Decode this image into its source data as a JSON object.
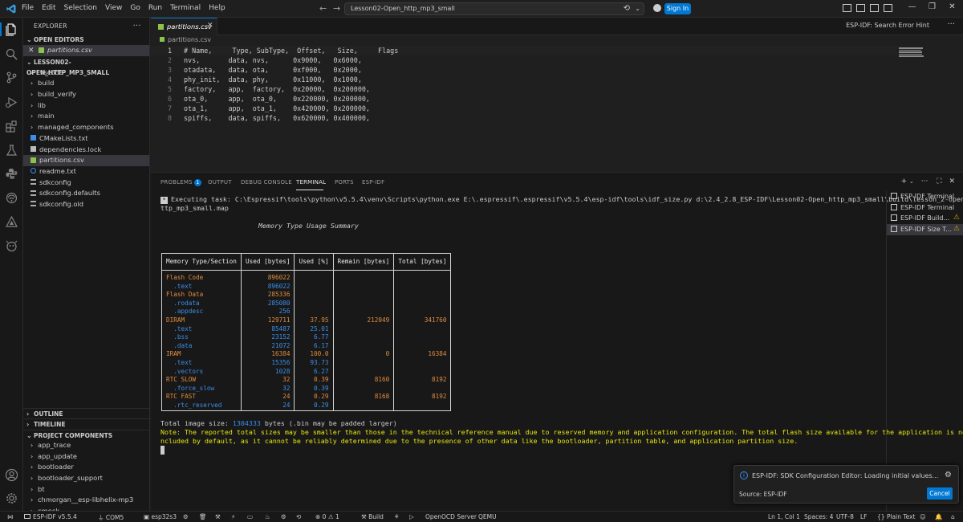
{
  "title_bar": {
    "menus": [
      "File",
      "Edit",
      "Selection",
      "View",
      "Go",
      "Run",
      "Terminal",
      "Help"
    ],
    "search_text": "Lesson02-Open_http_mp3_small",
    "sign_in": "Sign In"
  },
  "explorer": {
    "header": "EXPLORER",
    "open_editors_label": "OPEN EDITORS",
    "open_editor_file": "partitions.csv",
    "project_label": "LESSON02-OPEN_HTTP_MP3_SMALL",
    "items": [
      {
        "label": ".vscode",
        "kind": "folder"
      },
      {
        "label": "build",
        "kind": "folder"
      },
      {
        "label": "build_verify",
        "kind": "folder"
      },
      {
        "label": "lib",
        "kind": "folder"
      },
      {
        "label": "main",
        "kind": "folder"
      },
      {
        "label": "managed_components",
        "kind": "folder"
      },
      {
        "label": "CMakeLists.txt",
        "kind": "file"
      },
      {
        "label": "dependencies.lock",
        "kind": "file"
      },
      {
        "label": "partitions.csv",
        "kind": "file"
      },
      {
        "label": "readme.txt",
        "kind": "file"
      },
      {
        "label": "sdkconfig",
        "kind": "file"
      },
      {
        "label": "sdkconfig.defaults",
        "kind": "file"
      },
      {
        "label": "sdkconfig.old",
        "kind": "file"
      }
    ],
    "outline_label": "OUTLINE",
    "timeline_label": "TIMELINE",
    "project_components_label": "PROJECT COMPONENTS",
    "components": [
      "app_trace",
      "app_update",
      "bootloader",
      "bootloader_support",
      "bt",
      "chmorgan__esp-libhelix-mp3",
      "cmock"
    ]
  },
  "editor": {
    "tab_label": "partitions.csv",
    "right_label": "ESP-IDF: Search Error Hint",
    "breadcrumb": "partitions.csv",
    "lines": [
      "# Name,     Type, SubType,  Offset,   Size,     Flags",
      "nvs,       data, nvs,      0x9000,   0x6000,",
      "otadata,   data, ota,      0xf000,   0x2000,",
      "phy_init,  data, phy,      0x11000,  0x1000,",
      "factory,   app,  factory,  0x20000,  0x200000,",
      "ota_0,     app,  ota_0,    0x220000, 0x200000,",
      "ota_1,     app,  ota_1,    0x420000, 0x200000,",
      "spiffs,    data, spiffs,   0x620000, 0x400000,"
    ]
  },
  "panel": {
    "tabs": [
      "PROBLEMS",
      "OUTPUT",
      "DEBUG CONSOLE",
      "TERMINAL",
      "PORTS",
      "ESP-IDF"
    ],
    "problems_count": "1",
    "exec_line1": "Executing task: C:\\Espressif\\tools\\python\\v5.5.4\\venv\\Scripts\\python.exe E:\\.espressif\\.espressif\\v5.5.4\\esp-idf\\tools\\idf_size.py d:\\2.4_2.8_ESP-IDF\\Lesson02-Open_http_mp3_small\\build\\lesson_2-open_h",
    "exec_line2": "ttp_mp3_small.map",
    "summary_title": "Memory Type Usage Summary",
    "table_headers": [
      "Memory Type/Section",
      "Used [bytes]",
      "Used [%]",
      "Remain [bytes]",
      "Total [bytes]"
    ],
    "table_rows": [
      {
        "name": "Flash Code",
        "used": "896022",
        "pct": "",
        "remain": "",
        "total": "",
        "sub": false
      },
      {
        "name": "  .text",
        "used": "896022",
        "pct": "",
        "remain": "",
        "total": "",
        "sub": true
      },
      {
        "name": "Flash Data",
        "used": "285336",
        "pct": "",
        "remain": "",
        "total": "",
        "sub": false
      },
      {
        "name": "  .rodata",
        "used": "285080",
        "pct": "",
        "remain": "",
        "total": "",
        "sub": true
      },
      {
        "name": "  .appdesc",
        "used": "256",
        "pct": "",
        "remain": "",
        "total": "",
        "sub": true
      },
      {
        "name": "DIRAM",
        "used": "129711",
        "pct": "37.95",
        "remain": "212049",
        "total": "341760",
        "sub": false
      },
      {
        "name": "  .text",
        "used": "85487",
        "pct": "25.01",
        "remain": "",
        "total": "",
        "sub": true
      },
      {
        "name": "  .bss",
        "used": "23152",
        "pct": "6.77",
        "remain": "",
        "total": "",
        "sub": true
      },
      {
        "name": "  .data",
        "used": "21072",
        "pct": "6.17",
        "remain": "",
        "total": "",
        "sub": true
      },
      {
        "name": "IRAM",
        "used": "16384",
        "pct": "100.0",
        "remain": "0",
        "total": "16384",
        "sub": false
      },
      {
        "name": "  .text",
        "used": "15356",
        "pct": "93.73",
        "remain": "",
        "total": "",
        "sub": true
      },
      {
        "name": "  .vectors",
        "used": "1028",
        "pct": "6.27",
        "remain": "",
        "total": "",
        "sub": true
      },
      {
        "name": "RTC SLOW",
        "used": "32",
        "pct": "0.39",
        "remain": "8160",
        "total": "8192",
        "sub": false
      },
      {
        "name": "  .force_slow",
        "used": "32",
        "pct": "0.39",
        "remain": "",
        "total": "",
        "sub": true
      },
      {
        "name": "RTC FAST",
        "used": "24",
        "pct": "0.29",
        "remain": "8168",
        "total": "8192",
        "sub": false
      },
      {
        "name": "  .rtc_reserved",
        "used": "24",
        "pct": "0.29",
        "remain": "",
        "total": "",
        "sub": true
      }
    ],
    "total_prefix": "Total image size: ",
    "total_value": "1304333",
    "total_suffix": " bytes (.bin may be padded larger)",
    "note_line1": "Note: The reported total sizes may be smaller than those in the technical reference manual due to reserved memory and application configuration. The total flash size available for the application is not i",
    "note_line2": "ncluded by default, as it cannot be reliably determined due to the presence of other data like the bootloader, partition table, and application partition size.",
    "terminals": [
      {
        "label": "ESP-IDF Terminal",
        "warn": false
      },
      {
        "label": "ESP-IDF Terminal",
        "warn": false
      },
      {
        "label": "ESP-IDF Build...",
        "warn": true
      },
      {
        "label": "ESP-IDF Size T...",
        "warn": true
      }
    ]
  },
  "notification": {
    "message": "ESP-IDF: SDK Configuration Editor: Loading initial values...",
    "source": "Source: ESP-IDF",
    "cancel": "Cancel"
  },
  "status_bar": {
    "idf_version": "ESP-IDF v5.5.4",
    "port": "COM5",
    "target": "esp32s3",
    "errors": "0",
    "warnings": "1",
    "build": "Build",
    "openocd": "OpenOCD Server",
    "qemu": "QEMU",
    "cursor": "Ln 1, Col 1",
    "spaces": "Spaces: 4",
    "encoding": "UTF-8",
    "eol": "LF",
    "language": "Plain Text"
  }
}
